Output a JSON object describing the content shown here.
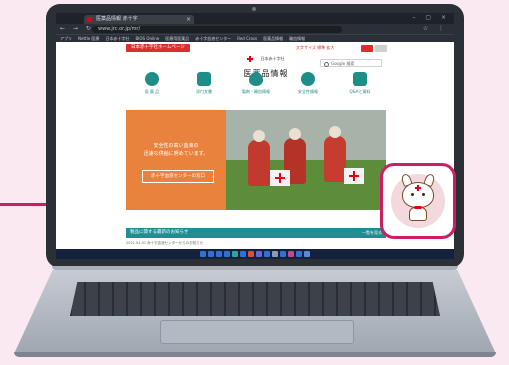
{
  "browser": {
    "tab_title": "医薬品情報 赤十字",
    "tab_close": "×",
    "window_controls": "– ▢ ×",
    "nav_buttons": "← → ↻",
    "address": "www.jrc.or.jp/mr/",
    "toolbar_icons": "☆ ⋮",
    "bookmarks": [
      "アプリ",
      "Nettle 医療",
      "日本赤十字社",
      "BIOS Online",
      "医療用医薬品",
      "赤十字血液センター",
      "Red Cross",
      "医薬品情報",
      "輸血情報"
    ]
  },
  "page": {
    "top_pill": "日本赤十字社ホームページ",
    "logo_org": "日本赤十字社",
    "logo_title": "医薬品情報",
    "utility_links": "文字サイズ  標準  拡大",
    "search_placeholder": "Google 検索",
    "nav": [
      {
        "label": "医 薬 品",
        "icon": "medical-icon"
      },
      {
        "label": "添付文書",
        "icon": "bottle-icon"
      },
      {
        "label": "製剤・輸血情報",
        "icon": "drop-icon"
      },
      {
        "label": "安全性情報",
        "icon": "shield-icon"
      },
      {
        "label": "Q&Aと資料",
        "icon": "document-icon"
      }
    ],
    "hero_text_1": "安全性の高い血液の",
    "hero_text_2": "迅速な供給に努めています。",
    "hero_button": "赤十字血液センターの窓口",
    "side_tab": "献血ルームへ",
    "news_title": "製品に関する最新のお知らせ",
    "news_more": "一覧を見る",
    "news_row": "2021.04.01  赤十字血液センターからのお知らせ"
  },
  "taskbar_colors": [
    "#2f6fd6",
    "#2f6fd6",
    "#2f6fd6",
    "#2f6fd6",
    "#26a6a0",
    "#2f6fd6",
    "#e24a3b",
    "#5f6ad6",
    "#2f6fd6",
    "#8f98b3",
    "#2f6fd6",
    "#c24b8a",
    "#2f6fd6",
    "#5b88d8"
  ],
  "colors": {
    "callout": "#cc1f63",
    "brand_red": "#e60012",
    "teal": "#1f8e89",
    "hero_orange": "#e8823c"
  }
}
